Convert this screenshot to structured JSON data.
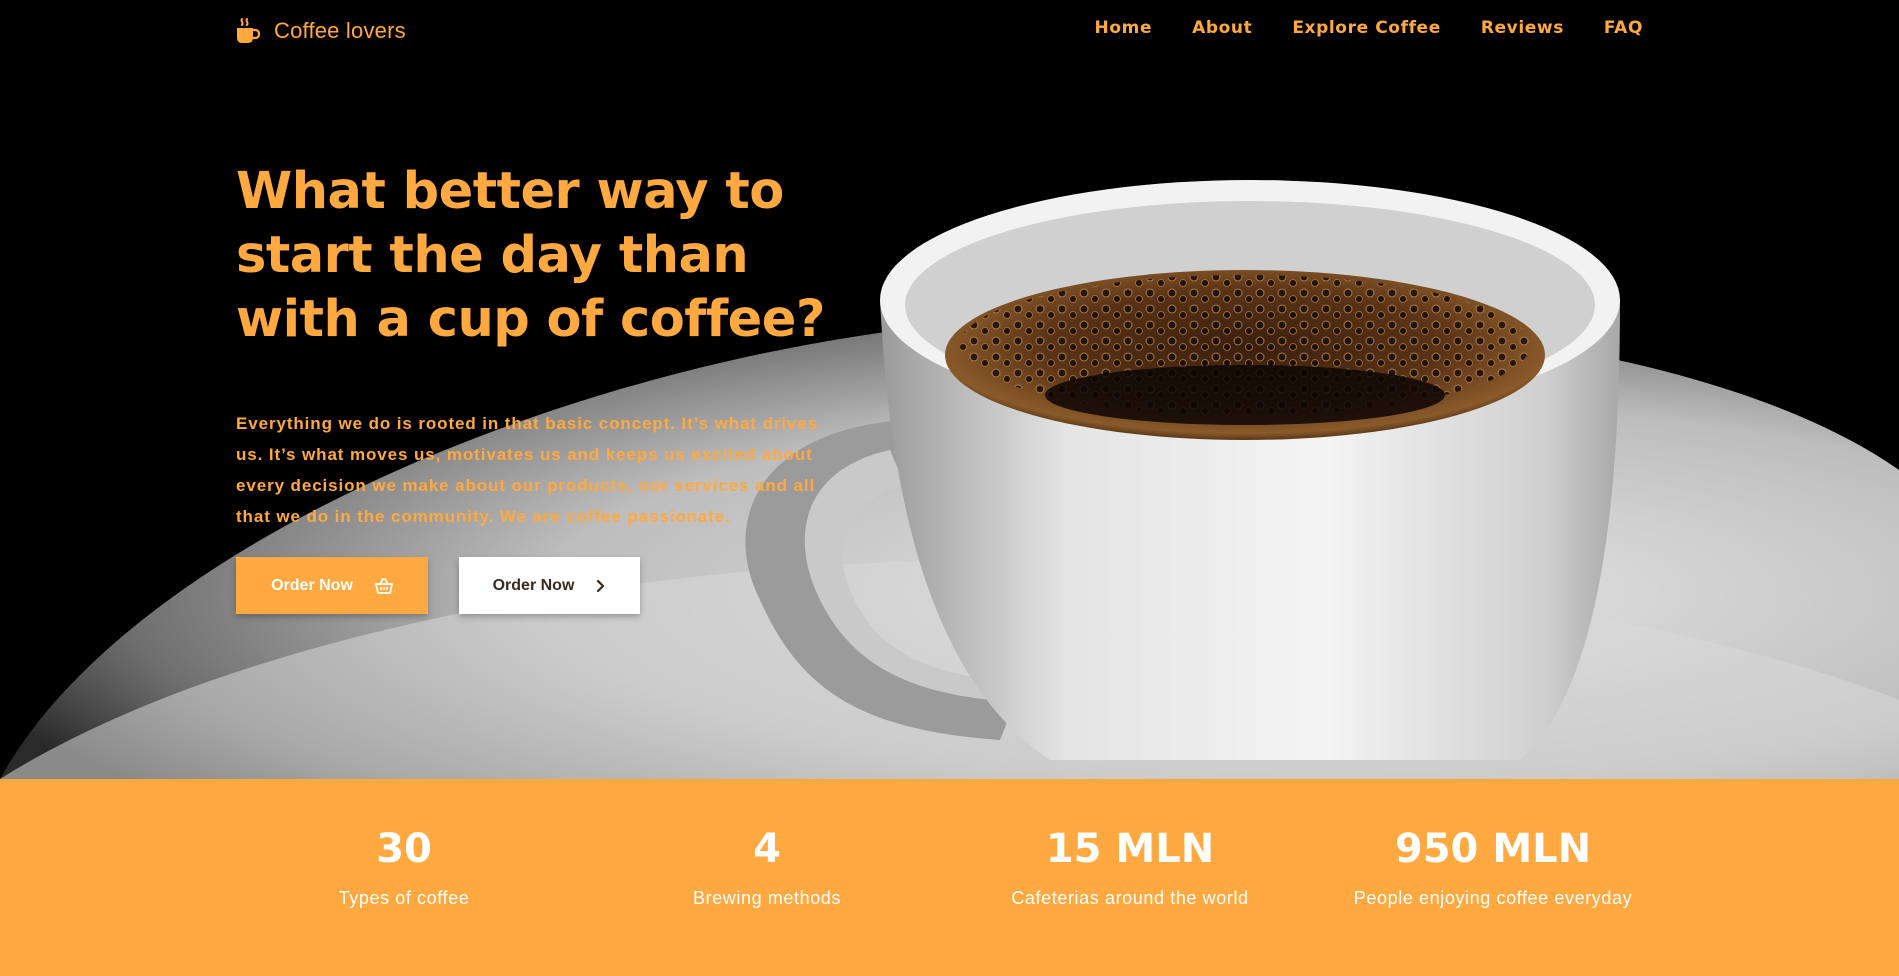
{
  "brand": {
    "name": "Coffee lovers",
    "icon": "coffee-cup-icon",
    "accent_color": "#ffa940"
  },
  "nav": {
    "links": [
      "Home",
      "About",
      "Explore Coffee",
      "Reviews",
      "FAQ"
    ]
  },
  "hero": {
    "headline": "What better way to start the day than with a cup of coffee?",
    "lead": "Everything we do is rooted in that basic concept. It’s what drives us. It’s what moves us, motivates us and keeps us excited about every decision we make about our products, our services and all that we do in the community. We are coffee passionate.",
    "primary_button": {
      "label": "Order Now",
      "icon": "basket-icon"
    },
    "secondary_button": {
      "label": "Order Now",
      "icon": "chevron-right-icon"
    }
  },
  "stats": [
    {
      "value": "30",
      "label": "Types of coffee"
    },
    {
      "value": "4",
      "label": "Brewing methods"
    },
    {
      "value": "15 MLN",
      "label": "Cafeterias around the world"
    },
    {
      "value": "950 MLN",
      "label": "People enjoying coffee everyday"
    }
  ]
}
